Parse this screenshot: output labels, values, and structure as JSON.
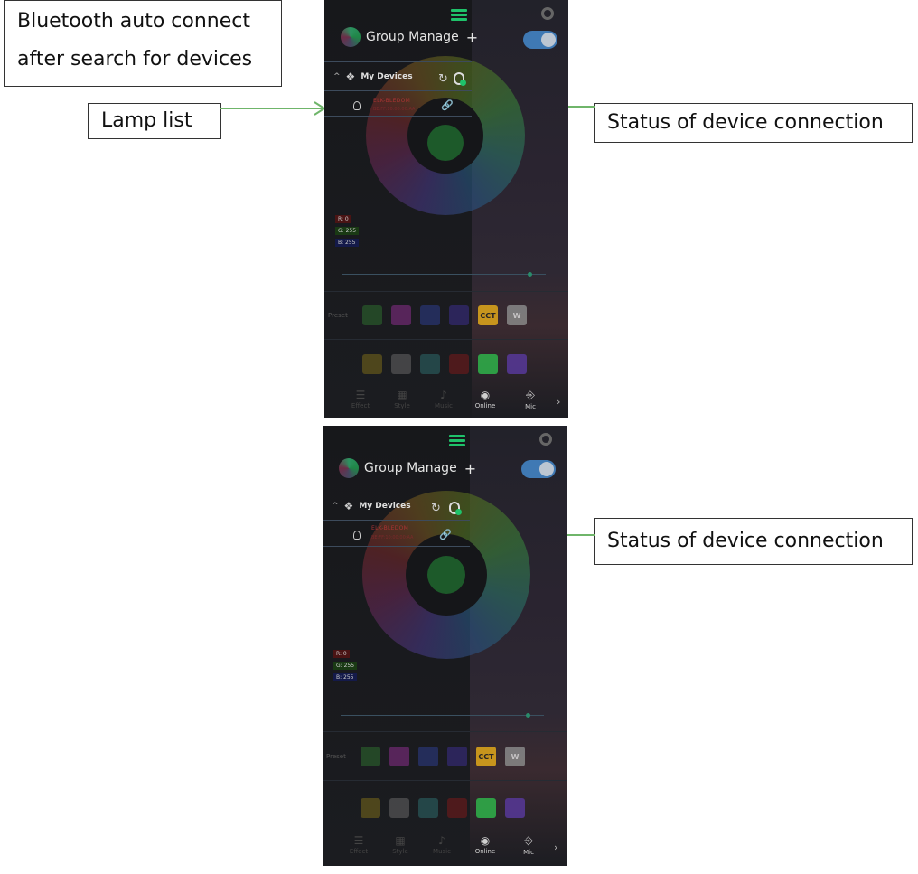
{
  "callouts": {
    "bluetooth_line1": "Bluetooth auto connect",
    "bluetooth_line2": "after search for devices",
    "lamp_list": "Lamp list",
    "status_top": "Status of device connection",
    "status_bottom": "Status of device connection"
  },
  "screens": [
    {
      "group_manage": "Group Manage",
      "plus": "+",
      "my_devices": "My Devices",
      "device_name": "ELK-BLEDOM",
      "device_mac": "BE:FF:10:00:00:AA",
      "rgb": [
        "R: 0",
        "G: 255",
        "B: 255"
      ],
      "preset_label": "Preset",
      "cct": "CCT",
      "w": "W",
      "tabs": [
        "Effect",
        "Style",
        "Music",
        "Online",
        "Mic"
      ],
      "active_tab": "Online"
    },
    {
      "group_manage": "Group Manage",
      "plus": "+",
      "my_devices": "My Devices",
      "device_name": "ELK-BLEDOM",
      "device_mac": "BE:FF:10:00:00:AA",
      "rgb": [
        "R: 0",
        "G: 255",
        "B: 255"
      ],
      "preset_label": "Preset",
      "cct": "CCT",
      "w": "W",
      "tabs": [
        "Effect",
        "Style",
        "Music",
        "Online",
        "Mic"
      ],
      "active_tab": "Online"
    }
  ],
  "colors": {
    "arrow": "#6fb56a",
    "accent_green": "#1fc26a",
    "toggle_blue": "#3f79b4"
  },
  "icons": [
    "list-icon",
    "gear-icon",
    "plus-icon",
    "toggle-switch",
    "lamp-group-icon",
    "refresh-icon",
    "bluetooth-search-icon",
    "bulb-icon",
    "link-icon",
    "chevron-right-icon"
  ]
}
